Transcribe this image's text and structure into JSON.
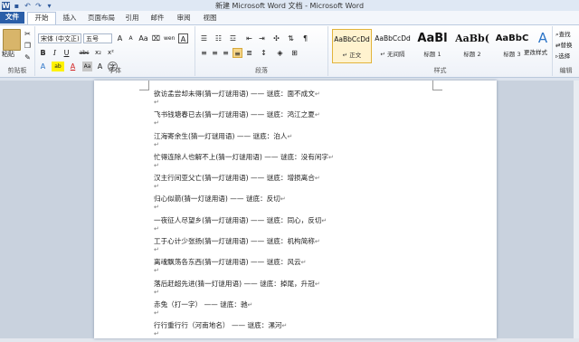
{
  "window": {
    "title": "新建 Microsoft Word 文档 - Microsoft Word"
  },
  "quick_access": [
    {
      "icon": "word-logo-icon",
      "glyph": "W"
    },
    {
      "icon": "save-icon",
      "glyph": "▪"
    },
    {
      "icon": "undo-icon",
      "glyph": "↶"
    },
    {
      "icon": "redo-icon",
      "glyph": "↷"
    },
    {
      "icon": "customize-qat-icon",
      "glyph": "▾"
    }
  ],
  "menu": {
    "file": "文件",
    "tabs": [
      "开始",
      "插入",
      "页面布局",
      "引用",
      "邮件",
      "审阅",
      "视图"
    ]
  },
  "ribbon": {
    "clipboard": {
      "paste_label": "粘贴",
      "group_label": "剪贴板"
    },
    "font": {
      "font_name": "宋体 (中文正)",
      "font_size": "五号",
      "group_label": "字体",
      "row1": [
        "A",
        "A",
        "Aa",
        "⌧",
        "wen",
        "A"
      ],
      "row2": [
        "B",
        "I",
        "U",
        "abc",
        "x₂",
        "x²"
      ],
      "row3": [
        "A",
        "ab",
        "A",
        "Aa",
        "A",
        "字"
      ]
    },
    "paragraph": {
      "group_label": "段落"
    },
    "styles": {
      "group_label": "样式",
      "items": [
        {
          "preview": "AaBbCcDd",
          "name": "↵ 正文"
        },
        {
          "preview": "AaBbCcDd",
          "name": "↵ 无间隔"
        },
        {
          "preview": "AaBl",
          "name": "标题 1"
        },
        {
          "preview": "AaBb(",
          "name": "标题 2"
        },
        {
          "preview": "AaBbC",
          "name": "标题 3"
        }
      ],
      "change_styles": "更改样式"
    },
    "editing": {
      "group_label": "编辑",
      "items": [
        "查找",
        "替换",
        "选择"
      ]
    }
  },
  "document": {
    "paragraph_mark": "↵",
    "lines": [
      "欲访孟尝却未得(猜一灯谜用语) —— 谜底：面不成文",
      "飞书钱塘春已去(猜一灯谜用语) —— 谜底：鸿江之夏",
      "江海寄余生(猜一灯谜用语) —— 谜底：泊人",
      "忙得连除人也解不上(猜一灯谜用语) —— 谜底：没有闲字",
      "汉主行间亚父亡(猜一灯谜用语) —— 谜底：增损离合",
      "归心似箭(猜一灯谜用语) —— 谜底：反切",
      "一夜征人尽望乡(猜一灯谜用语) —— 谜底：同心，反切",
      "工于心计少张扬(猜一灯谜用语) —— 谜底：机构简称",
      "离魂飘荡各东西(猜一灯谜用语) —— 谜底：风云",
      "落后赶超先进(猜一灯谜用语) —— 谜底：掉尾，升冠",
      "赤兔（打一字） —— 谜底：驰",
      "行行重行行（河南地名） —— 谜底：漯河"
    ]
  }
}
